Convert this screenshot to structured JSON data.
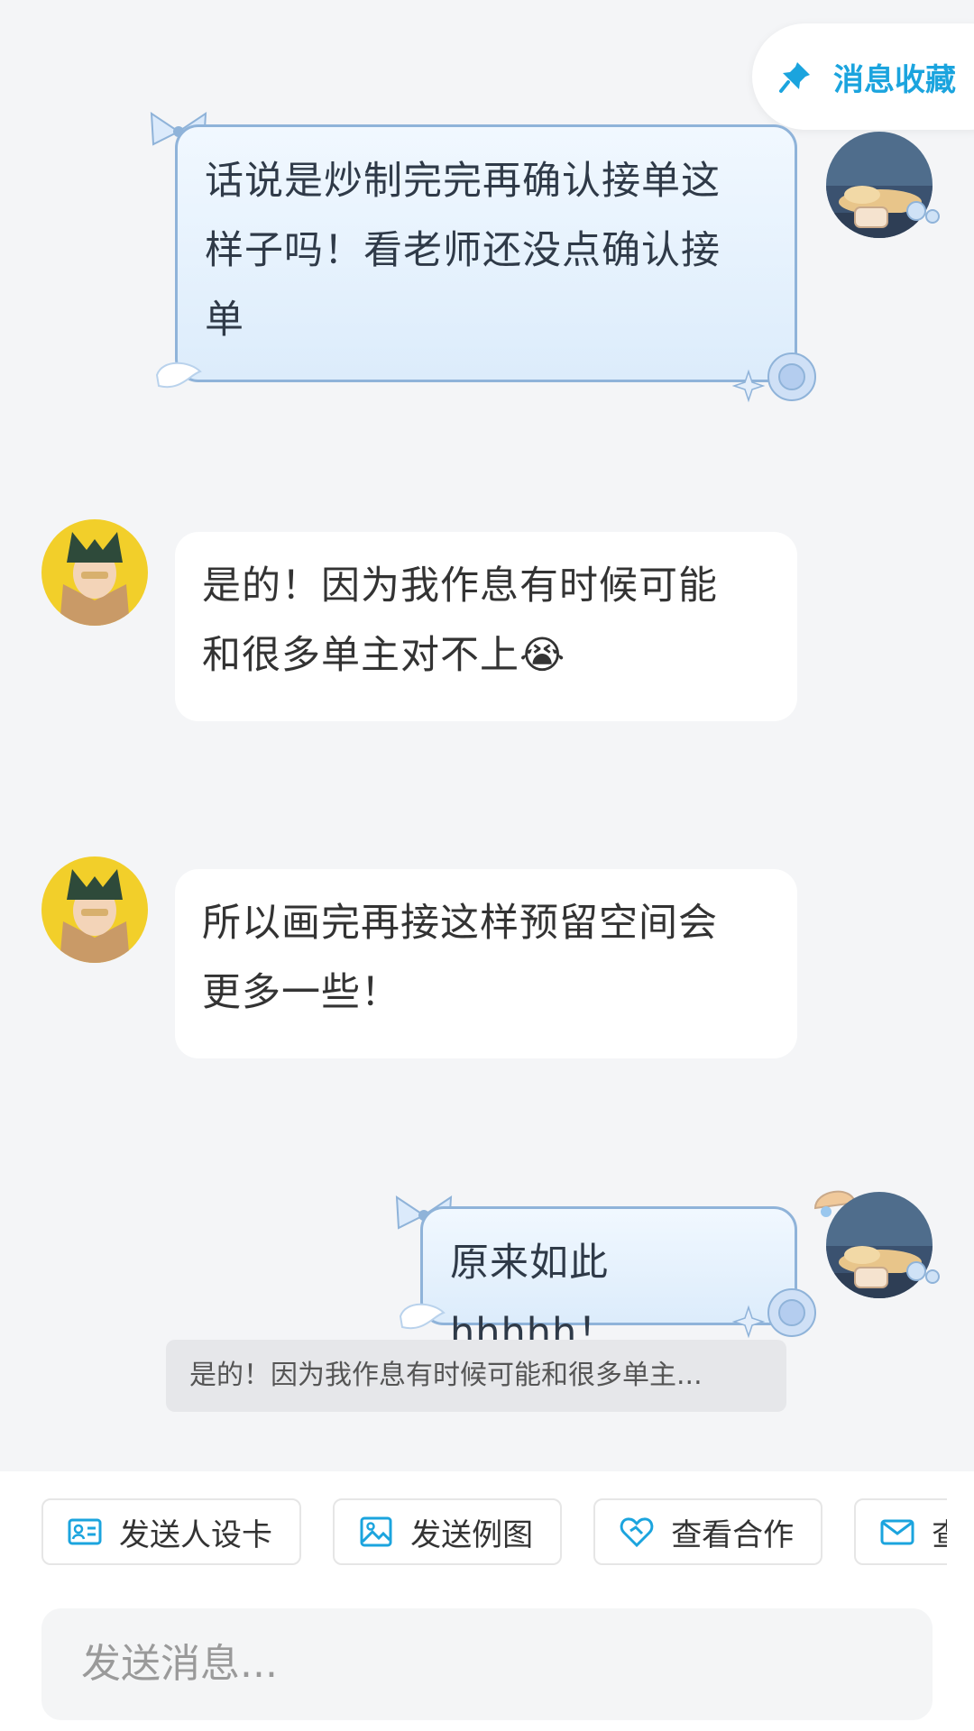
{
  "header": {
    "favorites_label": "消息收藏"
  },
  "messages": [
    {
      "side": "self",
      "lines": [
        "话说是炒制完完再确认接单这",
        "样子吗！看老师还没点确认接",
        "单"
      ]
    },
    {
      "side": "other",
      "lines": [
        "是的！因为我作息有时候可能",
        "和很多单主对不上😭"
      ]
    },
    {
      "side": "other",
      "lines": [
        "所以画完再接这样预留空间会",
        "更多一些！"
      ]
    },
    {
      "side": "self",
      "lines": [
        "原来如此hhhhh！"
      ],
      "quote": "是的！因为我作息有时候可能和很多单主..."
    }
  ],
  "actions": [
    {
      "label": "发送人设卡",
      "icon": "id-card-icon"
    },
    {
      "label": "发送例图",
      "icon": "image-icon"
    },
    {
      "label": "查看合作",
      "icon": "heart-handshake-icon"
    },
    {
      "label": "查",
      "icon": "mail-icon"
    }
  ],
  "input": {
    "placeholder": "发送消息..."
  },
  "colors": {
    "accent": "#1ba4de",
    "self_bubble_border": "#8fb3d9",
    "background": "#f4f5f7"
  }
}
